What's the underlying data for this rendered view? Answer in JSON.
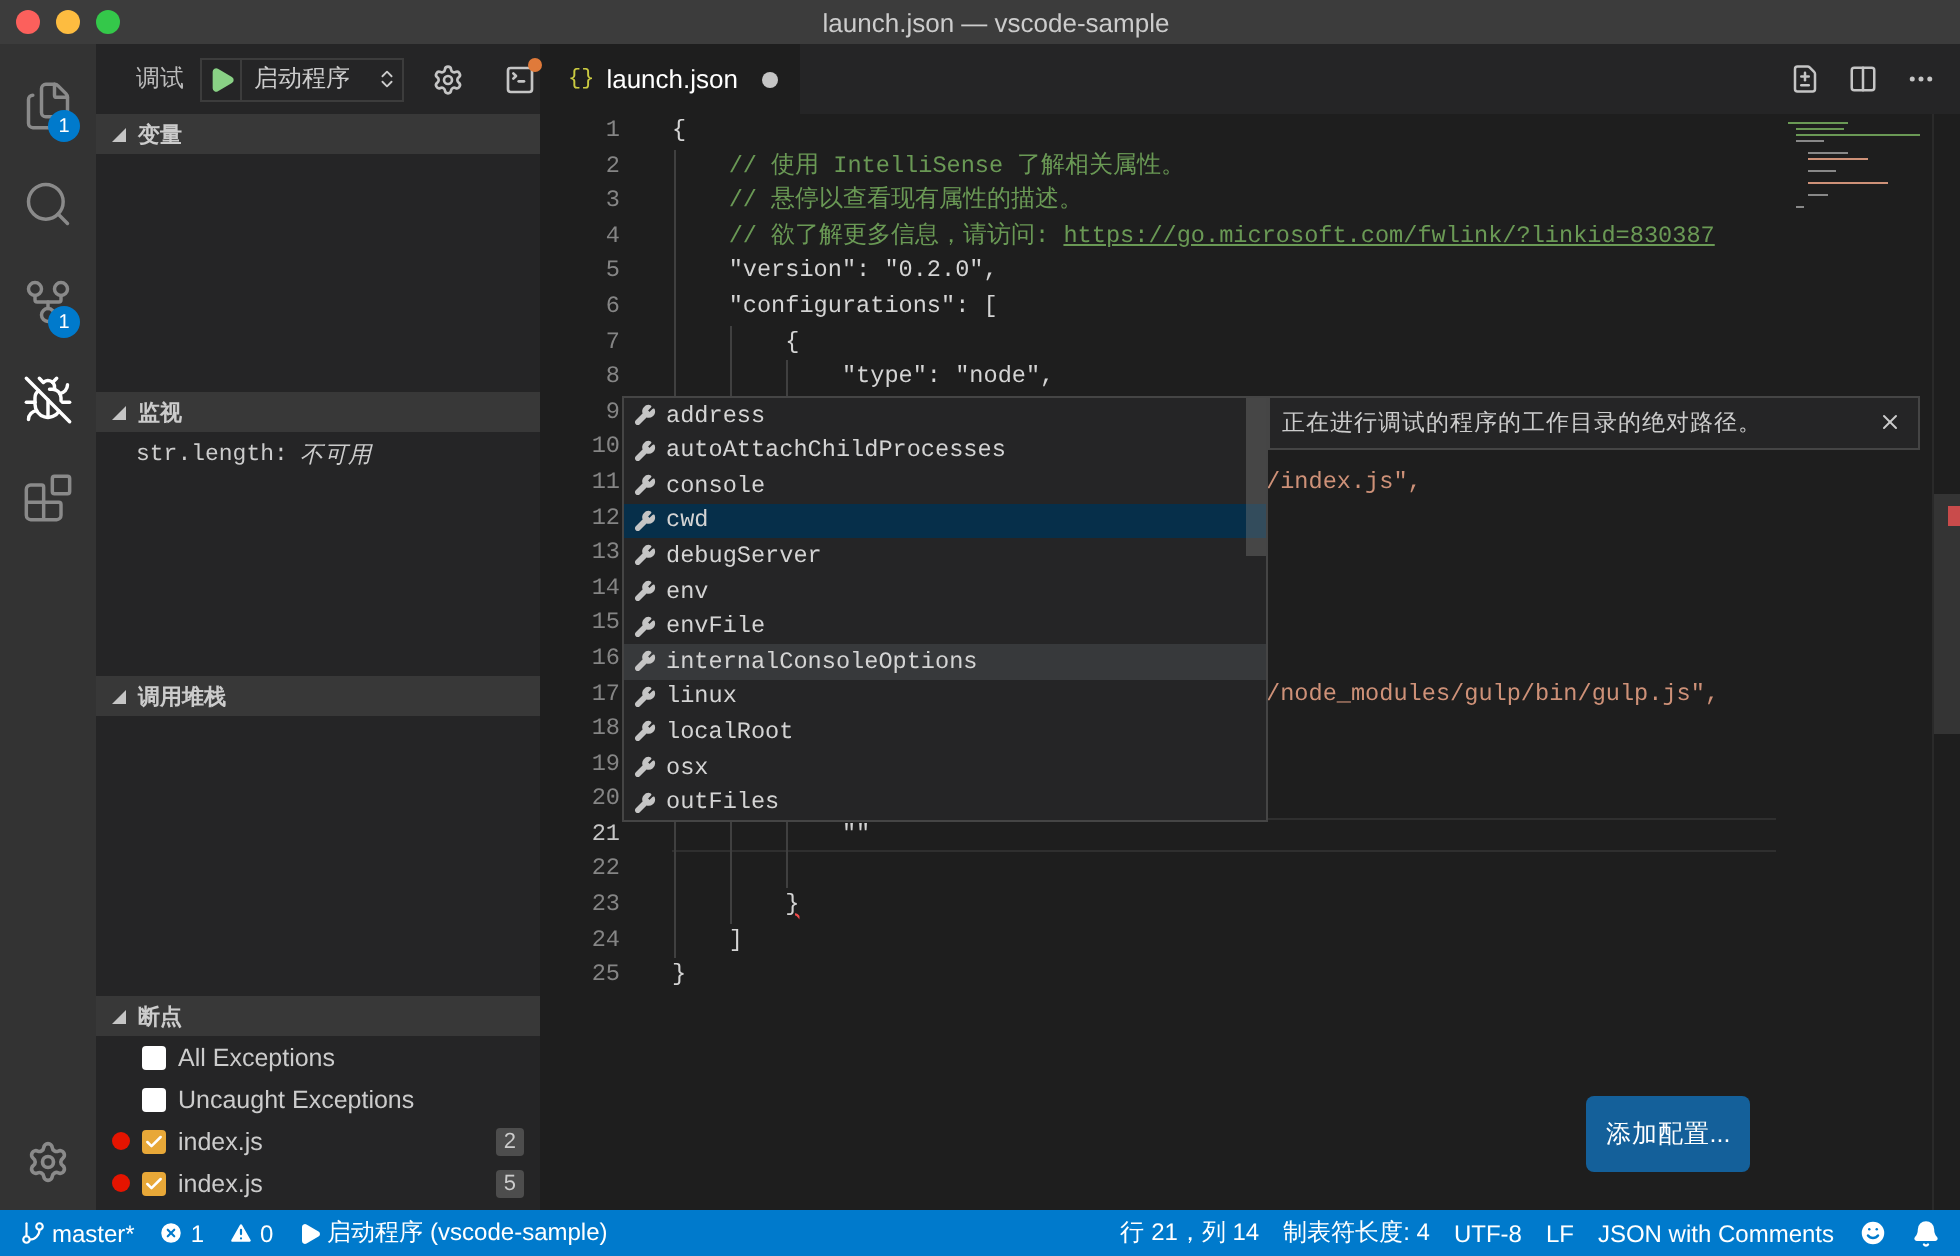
{
  "window": {
    "title": "launch.json — vscode-sample"
  },
  "activity_bar": {
    "items": [
      {
        "kind": "files",
        "badge": "1",
        "selected": false
      },
      {
        "kind": "search",
        "selected": false
      },
      {
        "kind": "git",
        "badge": "1",
        "selected": false
      },
      {
        "kind": "debug",
        "selected": true
      },
      {
        "kind": "extensions",
        "selected": false
      }
    ]
  },
  "debug_toolbar": {
    "label": "调试",
    "configuration": "启动程序",
    "console_alert": true
  },
  "sections": [
    {
      "kind": "variables",
      "title": "变量",
      "expanded": true
    },
    {
      "kind": "watch",
      "title": "监视",
      "expanded": true,
      "items": [
        {
          "expression": "str.length:",
          "value": "不可用"
        }
      ]
    },
    {
      "kind": "callstack",
      "title": "调用堆栈",
      "expanded": true
    },
    {
      "kind": "breakpoints",
      "title": "断点",
      "expanded": true,
      "items": [
        {
          "kind": "exception",
          "label": "All Exceptions",
          "checked": false
        },
        {
          "kind": "exception",
          "label": "Uncaught Exceptions",
          "checked": false
        },
        {
          "kind": "file",
          "label": "index.js",
          "checked": true,
          "line": "2"
        },
        {
          "kind": "file",
          "label": "index.js",
          "checked": true,
          "line": "5"
        }
      ]
    }
  ],
  "tabs": [
    {
      "icon_text": "{}",
      "label": "launch.json",
      "dirty": true,
      "selected": true
    }
  ],
  "editor": {
    "lines": [
      {
        "number": "1",
        "tokens": [
          {
            "text": "{",
            "kind": "plain"
          }
        ]
      },
      {
        "number": "2",
        "tokens": [
          {
            "text": "    // 使用 IntelliSense 了解相关属性。",
            "kind": "comment"
          }
        ]
      },
      {
        "number": "3",
        "tokens": [
          {
            "text": "    // 悬停以查看现有属性的描述。",
            "kind": "comment"
          }
        ]
      },
      {
        "number": "4",
        "tokens": [
          {
            "text": "    // 欲了解更多信息，请访问: ",
            "kind": "comment"
          },
          {
            "text": "https://go.microsoft.com/fwlink/?linkid=830387",
            "kind": "link"
          }
        ]
      },
      {
        "number": "5",
        "tokens": [
          {
            "text": "    \"version\": \"0.2.0\",",
            "kind": "plain"
          }
        ]
      },
      {
        "number": "6",
        "tokens": [
          {
            "text": "    \"configurations\": [",
            "kind": "plain"
          }
        ]
      },
      {
        "number": "7",
        "tokens": [
          {
            "text": "        {",
            "kind": "plain"
          }
        ]
      },
      {
        "number": "8",
        "tokens": [
          {
            "text": "            \"type\": \"node\",",
            "kind": "plain"
          }
        ]
      },
      {
        "number": "9",
        "kind": "partial"
      },
      {
        "number": "10",
        "kind": "partial"
      },
      {
        "number": "11",
        "kind": "partial",
        "tokens": [
          {
            "text": "/index.js\",",
            "kind": "string"
          }
        ]
      },
      {
        "number": "12",
        "kind": "partial"
      },
      {
        "number": "13",
        "kind": "partial"
      },
      {
        "number": "14",
        "kind": "partial"
      },
      {
        "number": "15",
        "kind": "partial"
      },
      {
        "number": "16",
        "kind": "partial"
      },
      {
        "number": "17",
        "kind": "partial",
        "tokens": [
          {
            "text": "/node_modules/gulp/bin/gulp.js\",",
            "kind": "string"
          }
        ]
      },
      {
        "number": "18",
        "kind": "partial"
      },
      {
        "number": "19",
        "kind": "partial"
      },
      {
        "number": "20",
        "kind": "partial"
      },
      {
        "number": "21",
        "current": true,
        "tokens": [
          {
            "text": "            \"\"",
            "kind": "plain"
          }
        ]
      },
      {
        "number": "22"
      },
      {
        "number": "23",
        "tokens": [
          {
            "text": "        }",
            "kind": "plain",
            "squiggle": true
          }
        ]
      },
      {
        "number": "24",
        "tokens": [
          {
            "text": "    ]",
            "kind": "plain"
          }
        ]
      },
      {
        "number": "25",
        "tokens": [
          {
            "text": "}",
            "kind": "plain"
          }
        ]
      }
    ]
  },
  "suggest": {
    "items": [
      {
        "label": "address",
        "selected": false,
        "hovered": false
      },
      {
        "label": "autoAttachChildProcesses",
        "selected": false,
        "hovered": false
      },
      {
        "label": "console",
        "selected": false,
        "hovered": false
      },
      {
        "label": "cwd",
        "selected": true,
        "hovered": false
      },
      {
        "label": "debugServer",
        "selected": false,
        "hovered": false
      },
      {
        "label": "env",
        "selected": false,
        "hovered": false
      },
      {
        "label": "envFile",
        "selected": false,
        "hovered": false
      },
      {
        "label": "internalConsoleOptions",
        "selected": false,
        "hovered": true
      },
      {
        "label": "linux",
        "selected": false,
        "hovered": false
      },
      {
        "label": "localRoot",
        "selected": false,
        "hovered": false
      },
      {
        "label": "osx",
        "selected": false,
        "hovered": false
      },
      {
        "label": "outFiles",
        "selected": false,
        "hovered": false
      }
    ],
    "detail": "正在进行调试的程序的工作目录的绝对路径。"
  },
  "add_configuration_button": "添加配置...",
  "status_bar": {
    "left": [
      {
        "kind": "branch",
        "text": "master*"
      },
      {
        "kind": "errors",
        "text": "1"
      },
      {
        "kind": "warnings",
        "text": "0"
      },
      {
        "kind": "launch",
        "text": "启动程序 (vscode-sample)"
      }
    ],
    "right": [
      {
        "kind": "text",
        "text": "行 21，列 14"
      },
      {
        "kind": "text",
        "text": "制表符长度: 4"
      },
      {
        "kind": "text",
        "text": "UTF-8"
      },
      {
        "kind": "text",
        "text": "LF"
      },
      {
        "kind": "text",
        "text": "JSON with Comments"
      },
      {
        "kind": "feedback"
      },
      {
        "kind": "bell"
      }
    ]
  }
}
